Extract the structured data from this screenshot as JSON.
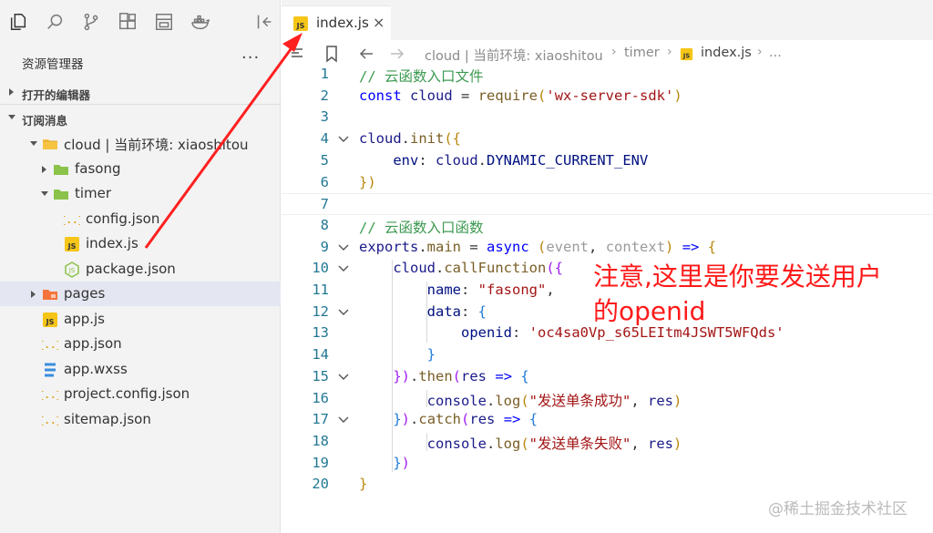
{
  "sidebar": {
    "icons": [
      "files-icon",
      "search-icon",
      "source-control-icon",
      "extensions-icon",
      "window-icon",
      "docker-icon",
      "collapse-panel-icon"
    ],
    "explorer_title": "资源管理器",
    "more": "···",
    "section_open_editors": "打开的编辑器",
    "section_workspace": "订阅消息",
    "tree": [
      {
        "label": "cloud | 当前环境: xiaoshitou",
        "kind": "cloud-folder",
        "expanded": true,
        "depth": 1
      },
      {
        "label": "fasong",
        "kind": "folder-green",
        "expanded": false,
        "depth": 2
      },
      {
        "label": "timer",
        "kind": "folder-green",
        "expanded": true,
        "depth": 2
      },
      {
        "label": "config.json",
        "kind": "json",
        "depth": 3
      },
      {
        "label": "index.js",
        "kind": "js",
        "depth": 3
      },
      {
        "label": "package.json",
        "kind": "node",
        "depth": 3
      },
      {
        "label": "pages",
        "kind": "folder-orange",
        "expanded": false,
        "depth": 1,
        "selected": true
      },
      {
        "label": "app.js",
        "kind": "js",
        "depth": 1
      },
      {
        "label": "app.json",
        "kind": "json",
        "depth": 1
      },
      {
        "label": "app.wxss",
        "kind": "css",
        "depth": 1
      },
      {
        "label": "project.config.json",
        "kind": "json",
        "depth": 1
      },
      {
        "label": "sitemap.json",
        "kind": "json",
        "depth": 1
      }
    ]
  },
  "editor": {
    "tab_label": "index.js",
    "tab_close": "×",
    "breadcrumb": [
      "cloud | 当前环境: xiaoshitou",
      "timer",
      "index.js",
      "..."
    ],
    "line_numbers": [
      "1",
      "2",
      "3",
      "4",
      "5",
      "6",
      "7",
      "8",
      "9",
      "10",
      "11",
      "12",
      "13",
      "14",
      "15",
      "16",
      "17",
      "18",
      "19",
      "20"
    ],
    "folds": [
      4,
      9,
      10,
      12,
      15,
      17
    ],
    "current_line": 7
  },
  "annotation": {
    "line1": "注意,这里是你要发送用户",
    "line2": "的openid"
  },
  "watermark": "@稀土掘金技术社区",
  "colors": {
    "annotation": "#ff1a1a",
    "line_number": "#237893",
    "comment": "#3d9a52",
    "keyword": "#0000ff",
    "string": "#a31515",
    "selected_row": "#e4e6f1"
  }
}
